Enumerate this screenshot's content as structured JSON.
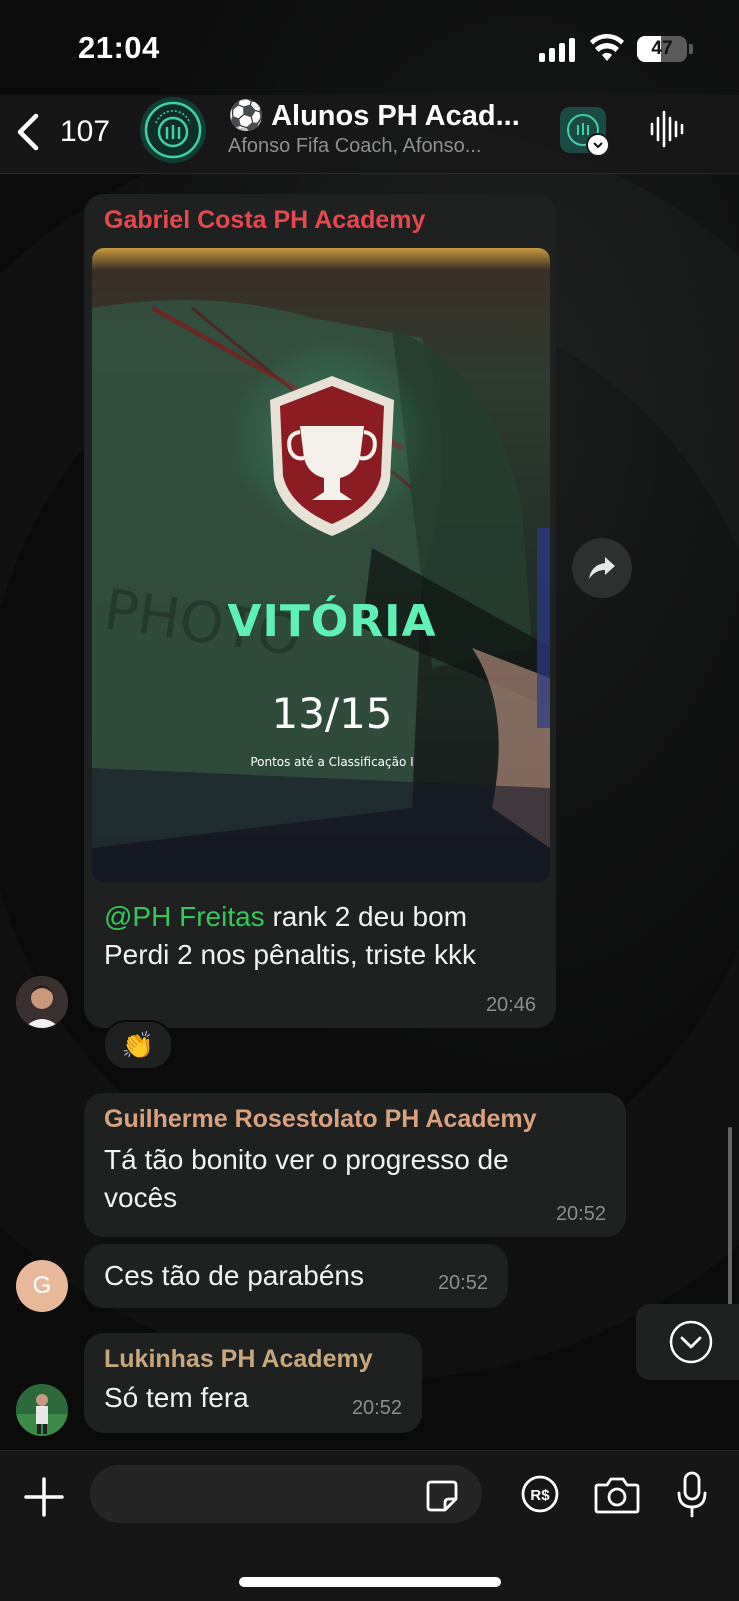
{
  "status_bar": {
    "time": "21:04",
    "battery": "47",
    "battery_level": 0.47
  },
  "header": {
    "back_count": "107",
    "title": "⚽ Alunos PH Acad...",
    "subtitle": "Afonso Fifa Coach, Afonso..."
  },
  "messages": [
    {
      "sender": "Gabriel Costa PH Academy",
      "sender_color": "#e5484d",
      "media": {
        "title": "VITÓRIA",
        "score": "13/15",
        "caption": "Pontos até a Classificação I"
      },
      "mention": "@PH Freitas",
      "mention_color": "#34c759",
      "text_rest": " rank 2 deu bom",
      "text_line2": "Perdi 2 nos pênaltis, triste kkk",
      "time": "20:46",
      "reaction": "👏"
    },
    {
      "sender": "Guilherme Rosestolato PH Academy",
      "sender_color": "#d9a27f",
      "text": "Tá tão bonito ver o progresso de vocês",
      "time": "20:52"
    },
    {
      "avatar_letter": "G",
      "avatar_color": "#e8b89b",
      "text": "Ces tão de parabéns",
      "time": "20:52"
    },
    {
      "sender": "Lukinhas PH Academy",
      "sender_color": "#c9a77c",
      "text": "Só tem fera",
      "time": "20:52"
    }
  ],
  "input": {
    "placeholder": "",
    "value": ""
  },
  "icons": {
    "back": "chevron-left-icon",
    "audio": "waveform-icon",
    "forward": "share-arrow-icon",
    "scroll_down": "chevron-down-circle-icon",
    "plus": "plus-icon",
    "sticker": "sticker-icon",
    "pay": "payment-rs-icon",
    "camera": "camera-icon",
    "mic": "microphone-icon"
  }
}
